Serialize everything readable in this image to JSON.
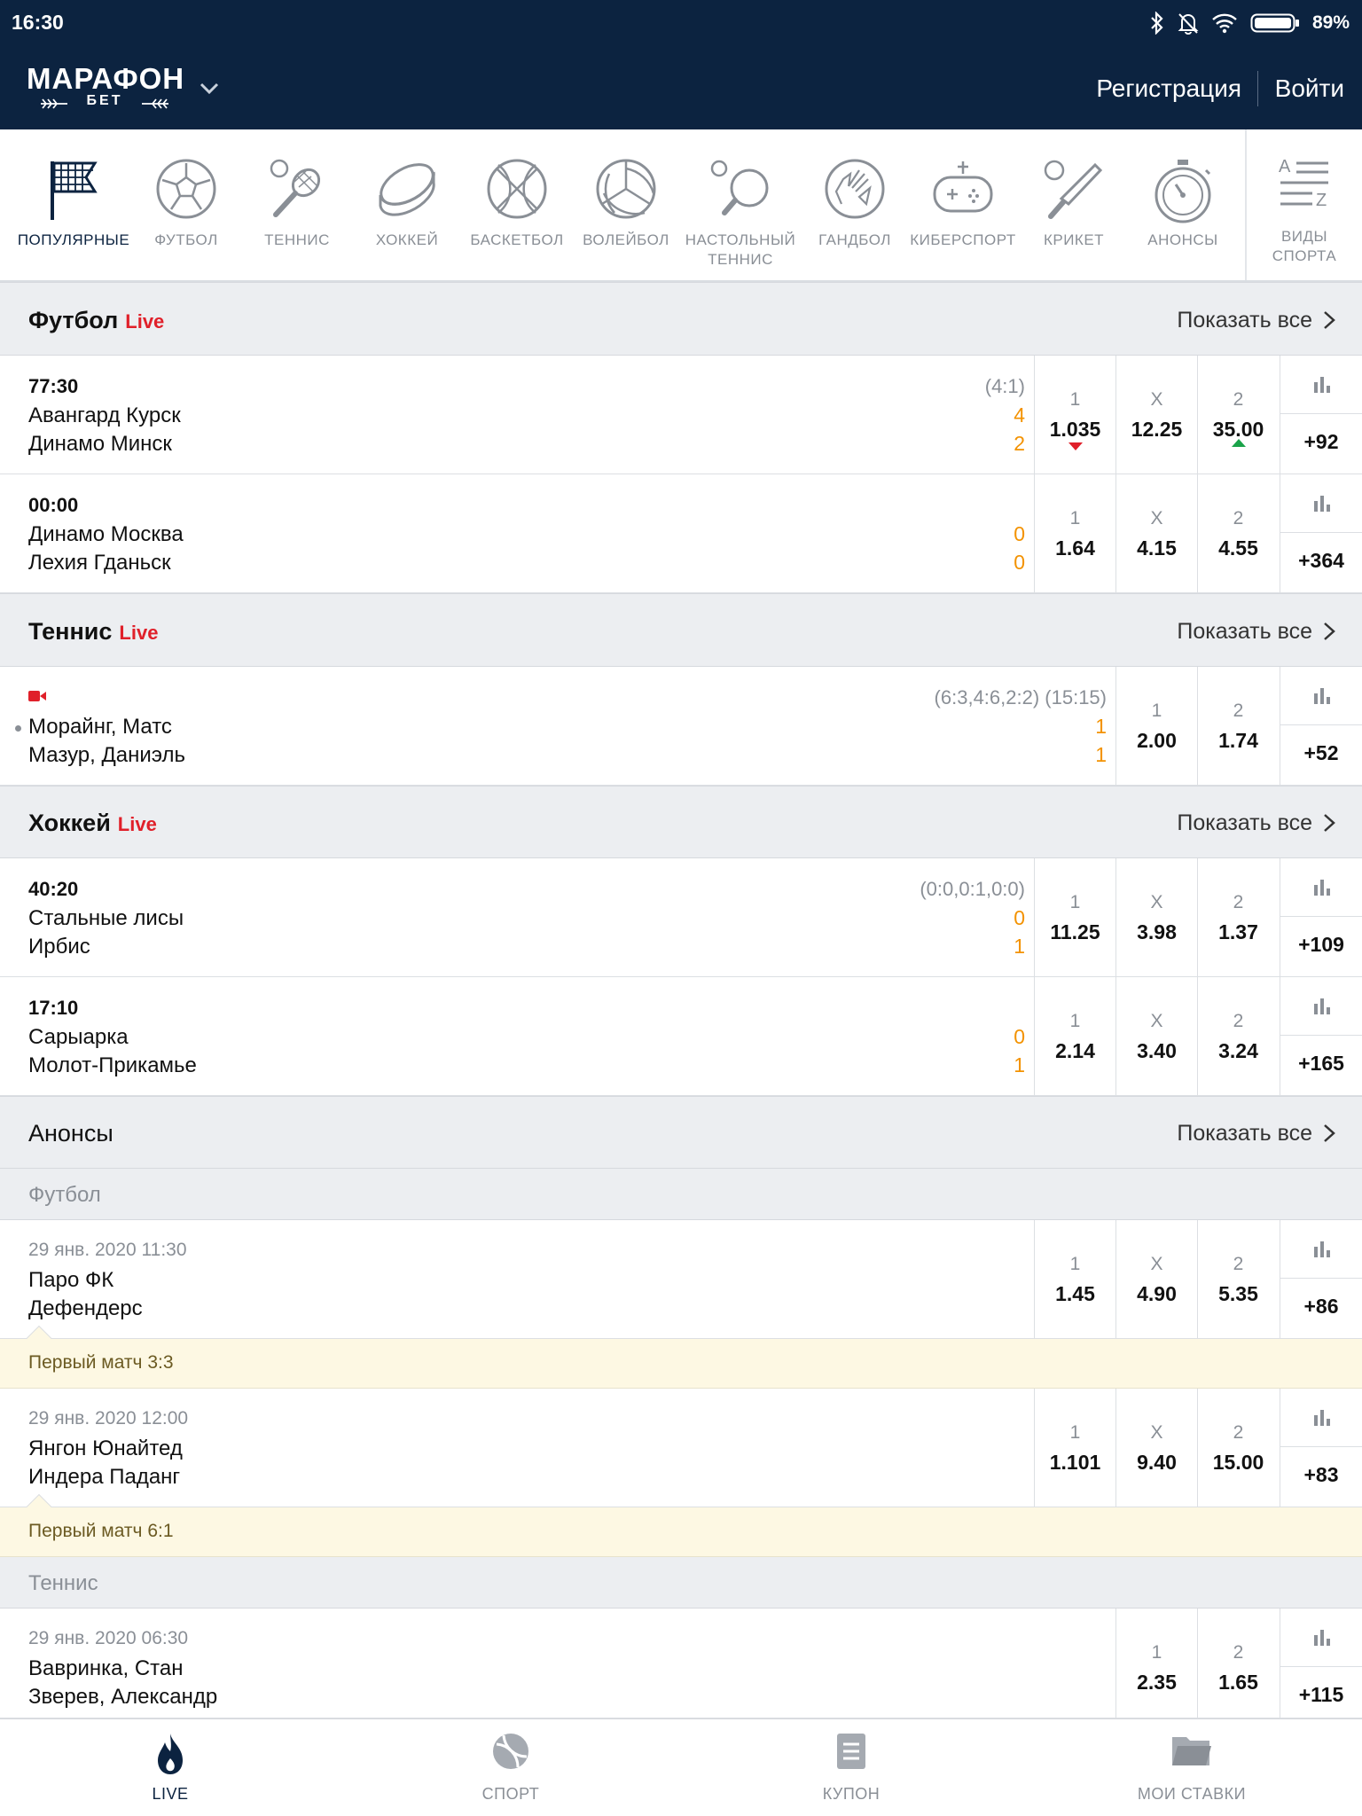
{
  "statusbar": {
    "time": "16:30",
    "battery": "89%"
  },
  "header": {
    "logo_main": "МАРАФОН",
    "logo_sub": "БЕТ",
    "register": "Регистрация",
    "login": "Войти"
  },
  "sports": [
    {
      "label": "ПОПУЛЯРНЫЕ",
      "icon": "flag-icon"
    },
    {
      "label": "ФУТБОЛ",
      "icon": "football-icon"
    },
    {
      "label": "ТЕННИС",
      "icon": "tennis-icon"
    },
    {
      "label": "ХОККЕЙ",
      "icon": "hockey-icon"
    },
    {
      "label": "БАСКЕТБОЛ",
      "icon": "basketball-icon"
    },
    {
      "label": "ВОЛЕЙБОЛ",
      "icon": "volleyball-icon"
    },
    {
      "label": "НАСТОЛЬНЫЙ",
      "label2": "ТЕННИС",
      "icon": "table-tennis-icon"
    },
    {
      "label": "ГАНДБОЛ",
      "icon": "handball-icon"
    },
    {
      "label": "КИБЕРСПОРТ",
      "icon": "gamepad-icon"
    },
    {
      "label": "КРИКЕТ",
      "icon": "cricket-icon"
    },
    {
      "label": "АНОНСЫ",
      "icon": "stopwatch-icon"
    },
    {
      "label": "ВИДЫ",
      "label2": "СПОРТА",
      "icon": "sort-az-icon"
    }
  ],
  "show_all": "Показать все",
  "live": "Live",
  "football": {
    "title": "Футбол",
    "rows": [
      {
        "time": "77:30",
        "team1": "Авангард Курск",
        "team2": "Динамо Минск",
        "summary": "(4:1)",
        "score1": "4",
        "score2": "2",
        "o1h": "1",
        "o1": "1.035",
        "oxh": "X",
        "ox": "12.25",
        "o2h": "2",
        "o2": "35.00",
        "more": "+92"
      },
      {
        "time": "00:00",
        "team1": "Динамо Москва",
        "team2": "Лехия Гданьск",
        "score1": "0",
        "score2": "0",
        "o1h": "1",
        "o1": "1.64",
        "oxh": "X",
        "ox": "4.15",
        "o2h": "2",
        "o2": "4.55",
        "more": "+364"
      }
    ]
  },
  "tennis": {
    "title": "Теннис",
    "rows": [
      {
        "team1": "Морайнг, Матс",
        "team2": "Мазур, Даниэль",
        "summary": "(6:3,4:6,2:2) (15:15)",
        "score1": "1",
        "score2": "1",
        "o1h": "1",
        "o1": "2.00",
        "o2h": "2",
        "o2": "1.74",
        "more": "+52"
      }
    ]
  },
  "hockey": {
    "title": "Хоккей",
    "rows": [
      {
        "time": "40:20",
        "team1": "Стальные лисы",
        "team2": "Ирбис",
        "summary": "(0:0,0:1,0:0)",
        "score1": "0",
        "score2": "1",
        "o1h": "1",
        "o1": "11.25",
        "oxh": "X",
        "ox": "3.98",
        "o2h": "2",
        "o2": "1.37",
        "more": "+109"
      },
      {
        "time": "17:10",
        "team1": "Сарыарка",
        "team2": "Молот-Прикамье",
        "score1": "0",
        "score2": "1",
        "o1h": "1",
        "o1": "2.14",
        "oxh": "X",
        "ox": "3.40",
        "o2h": "2",
        "o2": "3.24",
        "more": "+165"
      }
    ]
  },
  "announcements": {
    "title": "Анонсы",
    "football_sub": "Футбол",
    "tennis_sub": "Теннис",
    "rows": [
      {
        "date": "29 янв. 2020 11:30",
        "team1": "Паро ФК",
        "team2": "Дефендерс",
        "o1h": "1",
        "o1": "1.45",
        "oxh": "X",
        "ox": "4.90",
        "o2h": "2",
        "o2": "5.35",
        "more": "+86",
        "note": "Первый матч 3:3"
      },
      {
        "date": "29 янв. 2020 12:00",
        "team1": "Янгон Юнайтед",
        "team2": "Индера Паданг",
        "o1h": "1",
        "o1": "1.101",
        "oxh": "X",
        "ox": "9.40",
        "o2h": "2",
        "o2": "15.00",
        "more": "+83",
        "note": "Первый матч 6:1"
      },
      {
        "date": "29 янв. 2020 06:30",
        "team1": "Вавринка, Стан",
        "team2": "Зверев, Александр",
        "o1h": "1",
        "o1": "2.35",
        "o2h": "2",
        "o2": "1.65",
        "more": "+115"
      }
    ]
  },
  "bottomnav": [
    {
      "label": "LIVE",
      "icon": "fire-icon"
    },
    {
      "label": "СПОРТ",
      "icon": "ball-icon"
    },
    {
      "label": "КУПОН",
      "icon": "coupon-icon"
    },
    {
      "label": "МОИ СТАВКИ",
      "icon": "folder-icon"
    }
  ],
  "colors": {
    "navy": "#0c2340",
    "live_red": "#e0202a",
    "score_orange": "#f39200",
    "up_green": "#1aa34a"
  }
}
